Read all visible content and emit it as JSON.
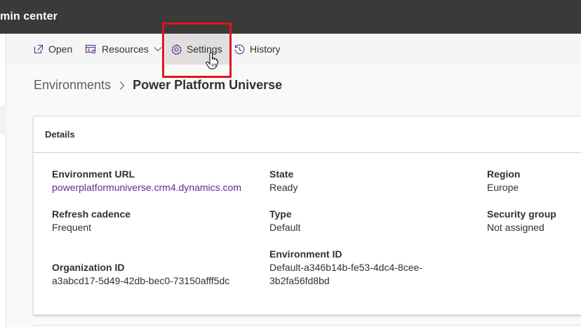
{
  "app": {
    "title": "min center"
  },
  "commands": {
    "open": "Open",
    "resources": "Resources",
    "settings": "Settings",
    "history": "History"
  },
  "breadcrumb": {
    "parent": "Environments",
    "current": "Power Platform Universe"
  },
  "details": {
    "header": "Details",
    "environment_url": {
      "label": "Environment URL",
      "value": "powerplatformuniverse.crm4.dynamics.com"
    },
    "state": {
      "label": "State",
      "value": "Ready"
    },
    "region": {
      "label": "Region",
      "value": "Europe"
    },
    "refresh_cadence": {
      "label": "Refresh cadence",
      "value": "Frequent"
    },
    "type": {
      "label": "Type",
      "value": "Default"
    },
    "security_group": {
      "label": "Security group",
      "value": "Not assigned"
    },
    "organization_id": {
      "label": "Organization ID",
      "value": "a3abcd17-5d49-42db-bec0-73150afff5dc"
    },
    "environment_id": {
      "label": "Environment ID",
      "value_line1": "Default-a346b14b-fe53-4dc4-8cee-",
      "value_line2": "3b2fa56fd8bd"
    }
  },
  "colors": {
    "topbar": "#3b3a39",
    "accent_link": "#5c2e91",
    "highlight": "#e0141e"
  },
  "icons": [
    "open-external-icon",
    "resources-icon",
    "chevron-down-icon",
    "gear-icon",
    "history-icon",
    "chevron-right-icon",
    "hand-cursor-icon"
  ]
}
